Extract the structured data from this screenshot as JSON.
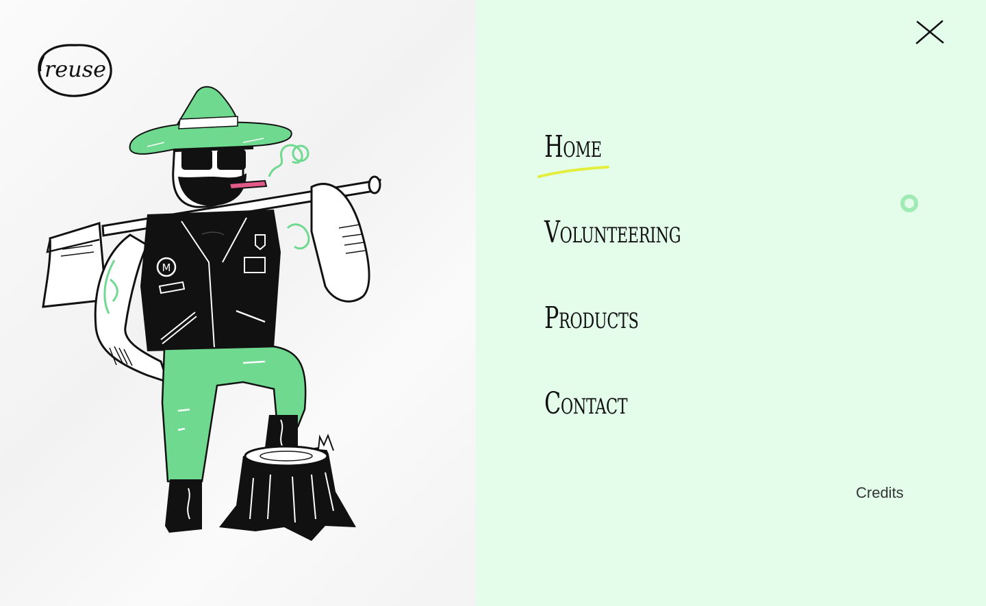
{
  "logo": {
    "text": "reuse"
  },
  "menu": {
    "items": [
      {
        "label": "Home",
        "active": true
      },
      {
        "label": "Volunteering",
        "active": false
      },
      {
        "label": "Products",
        "active": false
      },
      {
        "label": "Contact",
        "active": false
      }
    ],
    "close_icon": "close-icon"
  },
  "footer": {
    "credits_label": "Credits"
  },
  "colors": {
    "menu_background": "#e3fdea",
    "accent_green": "#6fd98f",
    "highlight_yellow": "#e4ee3c",
    "ink": "#111111"
  },
  "illustration": {
    "subject": "lumberjack-illustration"
  }
}
